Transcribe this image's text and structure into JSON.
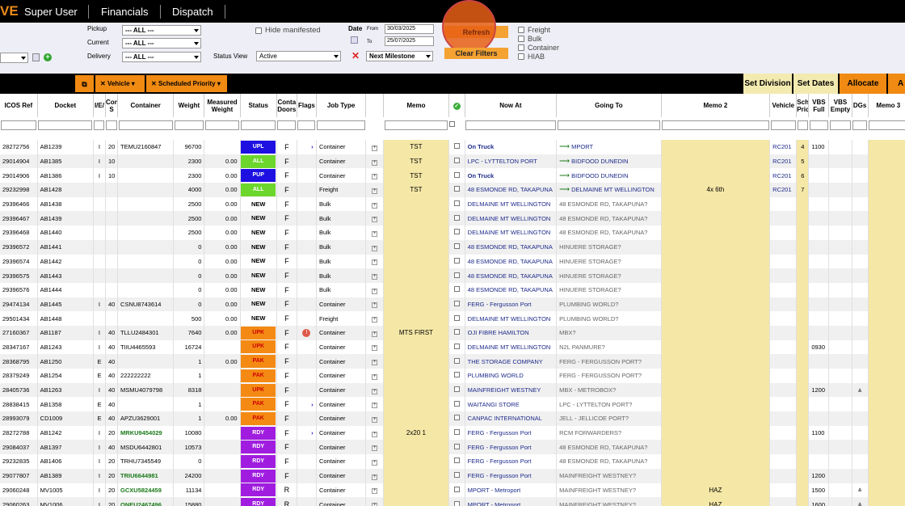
{
  "topbar": {
    "logo": "VE",
    "nav": [
      "Super User",
      "Financials",
      "Dispatch"
    ]
  },
  "filters": {
    "pickup_label": "Pickup",
    "current_label": "Current",
    "delivery_label": "Delivery",
    "pickup_value": "--- ALL ---",
    "current_value": "--- ALL ---",
    "delivery_value": "--- ALL ---",
    "hide_manifested": "Hide manifested",
    "date_label": "Date",
    "from_label": "From",
    "to_label": "To",
    "date_from": "30/03/2025",
    "date_to": "25/07/2025",
    "status_view_label": "Status View",
    "status_view_value": "Active",
    "milestone_value": "Next Milestone",
    "refresh": "Refresh",
    "clear_filters": "Clear Filters",
    "types": [
      "Freight",
      "Bulk",
      "Container",
      "HIAB"
    ]
  },
  "toolbar": {
    "vehicle": "Vehicle",
    "sched": "Scheduled Priority",
    "set_division": "Set Division",
    "set_dates": "Set Dates",
    "allocate": "Allocate",
    "last": "A"
  },
  "columns": [
    "ICOS Ref",
    "Docket",
    "I/E/",
    "Cont. S",
    "Container",
    "Weight",
    "Measured Weight",
    "Status",
    "Conta Doors",
    "Flags",
    "Job Type",
    "",
    "Memo",
    "",
    "Now At",
    "Going To",
    "Memo 2",
    "Vehicle",
    "Sch Pric",
    "VBS Full",
    "VBS Empty",
    "DGs",
    "Memo 3"
  ],
  "rows": [
    {
      "ref": "28272756",
      "docket": "AB1239",
      "ie": "I",
      "size": "20",
      "cont": "TEMU2160847",
      "weight": "96700",
      "mw": "",
      "status": "UPL",
      "doors": "F",
      "flag": "arrow",
      "job": "Container",
      "memo": "TST",
      "now": "On Truck",
      "now_bold": true,
      "going": "MPORT",
      "going_arrow": true,
      "memo2": "",
      "veh": "RC201",
      "sch": "4",
      "vbsf": "1100",
      "vbse": "",
      "dg": false
    },
    {
      "ref": "29014904",
      "docket": "AB1385",
      "ie": "I",
      "size": "10",
      "cont": "",
      "weight": "2300",
      "mw": "0.00",
      "status": "ALL",
      "doors": "F",
      "flag": "",
      "job": "Container",
      "memo": "TST",
      "now": "LPC - LYTTELTON PORT",
      "now_bold": false,
      "going": "BIDFOOD DUNEDIN",
      "going_arrow": true,
      "memo2": "",
      "veh": "RC201",
      "sch": "5",
      "vbsf": "",
      "vbse": "",
      "dg": false
    },
    {
      "ref": "29014906",
      "docket": "AB1386",
      "ie": "I",
      "size": "10",
      "cont": "",
      "weight": "2300",
      "mw": "0.00",
      "status": "PUP",
      "doors": "F",
      "flag": "",
      "job": "Container",
      "memo": "TST",
      "now": "On Truck",
      "now_bold": true,
      "going": "BIDFOOD DUNEDIN",
      "going_arrow": true,
      "memo2": "",
      "veh": "RC201",
      "sch": "6",
      "vbsf": "",
      "vbse": "",
      "dg": false
    },
    {
      "ref": "29232998",
      "docket": "AB1428",
      "ie": "",
      "size": "",
      "cont": "",
      "weight": "4000",
      "mw": "0.00",
      "status": "ALL",
      "doors": "F",
      "flag": "",
      "job": "Freight",
      "memo": "TST",
      "now": "48 ESMONDE RD, TAKAPUNA",
      "now_bold": false,
      "going": "DELMAINE MT WELLINGTON",
      "going_arrow": true,
      "memo2": "4x 6th",
      "veh": "RC201",
      "sch": "7",
      "vbsf": "",
      "vbse": "",
      "dg": false
    },
    {
      "ref": "29396466",
      "docket": "AB1438",
      "ie": "",
      "size": "",
      "cont": "",
      "weight": "2500",
      "mw": "0.00",
      "status": "NEW",
      "doors": "F",
      "flag": "",
      "job": "Bulk",
      "memo": "",
      "now": "DELMAINE MT WELLINGTON",
      "now_bold": false,
      "going": "48 ESMONDE RD, TAKAPUNA?",
      "going_arrow": false,
      "memo2": "",
      "veh": "",
      "sch": "",
      "vbsf": "",
      "vbse": "",
      "dg": false
    },
    {
      "ref": "29396467",
      "docket": "AB1439",
      "ie": "",
      "size": "",
      "cont": "",
      "weight": "2500",
      "mw": "0.00",
      "status": "NEW",
      "doors": "F",
      "flag": "",
      "job": "Bulk",
      "memo": "",
      "now": "DELMAINE MT WELLINGTON",
      "now_bold": false,
      "going": "48 ESMONDE RD, TAKAPUNA?",
      "going_arrow": false,
      "memo2": "",
      "veh": "",
      "sch": "",
      "vbsf": "",
      "vbse": "",
      "dg": false
    },
    {
      "ref": "29396468",
      "docket": "AB1440",
      "ie": "",
      "size": "",
      "cont": "",
      "weight": "2500",
      "mw": "0.00",
      "status": "NEW",
      "doors": "F",
      "flag": "",
      "job": "Bulk",
      "memo": "",
      "now": "DELMAINE MT WELLINGTON",
      "now_bold": false,
      "going": "48 ESMONDE RD, TAKAPUNA?",
      "going_arrow": false,
      "memo2": "",
      "veh": "",
      "sch": "",
      "vbsf": "",
      "vbse": "",
      "dg": false
    },
    {
      "ref": "29396572",
      "docket": "AB1441",
      "ie": "",
      "size": "",
      "cont": "",
      "weight": "0",
      "mw": "0.00",
      "status": "NEW",
      "doors": "F",
      "flag": "",
      "job": "Bulk",
      "memo": "",
      "now": "48 ESMONDE RD, TAKAPUNA",
      "now_bold": false,
      "going": "HINUERE STORAGE?",
      "going_arrow": false,
      "memo2": "",
      "veh": "",
      "sch": "",
      "vbsf": "",
      "vbse": "",
      "dg": false
    },
    {
      "ref": "29396574",
      "docket": "AB1442",
      "ie": "",
      "size": "",
      "cont": "",
      "weight": "0",
      "mw": "0.00",
      "status": "NEW",
      "doors": "F",
      "flag": "",
      "job": "Bulk",
      "memo": "",
      "now": "48 ESMONDE RD, TAKAPUNA",
      "now_bold": false,
      "going": "HINUERE STORAGE?",
      "going_arrow": false,
      "memo2": "",
      "veh": "",
      "sch": "",
      "vbsf": "",
      "vbse": "",
      "dg": false
    },
    {
      "ref": "29396575",
      "docket": "AB1443",
      "ie": "",
      "size": "",
      "cont": "",
      "weight": "0",
      "mw": "0.00",
      "status": "NEW",
      "doors": "F",
      "flag": "",
      "job": "Bulk",
      "memo": "",
      "now": "48 ESMONDE RD, TAKAPUNA",
      "now_bold": false,
      "going": "HINUERE STORAGE?",
      "going_arrow": false,
      "memo2": "",
      "veh": "",
      "sch": "",
      "vbsf": "",
      "vbse": "",
      "dg": false
    },
    {
      "ref": "29396576",
      "docket": "AB1444",
      "ie": "",
      "size": "",
      "cont": "",
      "weight": "0",
      "mw": "0.00",
      "status": "NEW",
      "doors": "F",
      "flag": "",
      "job": "Bulk",
      "memo": "",
      "now": "48 ESMONDE RD, TAKAPUNA",
      "now_bold": false,
      "going": "HINUERE STORAGE?",
      "going_arrow": false,
      "memo2": "",
      "veh": "",
      "sch": "",
      "vbsf": "",
      "vbse": "",
      "dg": false
    },
    {
      "ref": "29474134",
      "docket": "AB1445",
      "ie": "I",
      "size": "40",
      "cont": "CSNU8743614",
      "weight": "0",
      "mw": "0.00",
      "status": "NEW",
      "doors": "F",
      "flag": "",
      "job": "Container",
      "memo": "",
      "now": "FERG - Fergusson Port",
      "now_bold": false,
      "going": "PLUMBING WORLD?",
      "going_arrow": false,
      "memo2": "",
      "veh": "",
      "sch": "",
      "vbsf": "",
      "vbse": "",
      "dg": false
    },
    {
      "ref": "29501434",
      "docket": "AB1448",
      "ie": "",
      "size": "",
      "cont": "",
      "weight": "500",
      "mw": "0.00",
      "status": "NEW",
      "doors": "F",
      "flag": "",
      "job": "Freight",
      "memo": "",
      "now": "DELMAINE MT WELLINGTON",
      "now_bold": false,
      "going": "PLUMBING WORLD?",
      "going_arrow": false,
      "memo2": "",
      "veh": "",
      "sch": "",
      "vbsf": "",
      "vbse": "",
      "dg": false
    },
    {
      "ref": "27160367",
      "docket": "AB1187",
      "ie": "I",
      "size": "40",
      "cont": "TLLU2484301",
      "weight": "7640",
      "mw": "0.00",
      "status": "UPK",
      "doors": "F",
      "flag": "alert",
      "job": "Container",
      "memo": "MTS FIRST",
      "now": "OJI FIBRE HAMILTON",
      "now_bold": false,
      "going": "MBX?",
      "going_arrow": false,
      "memo2": "",
      "veh": "",
      "sch": "",
      "vbsf": "",
      "vbse": "",
      "dg": false
    },
    {
      "ref": "28347167",
      "docket": "AB1243",
      "ie": "I",
      "size": "40",
      "cont": "TIIU4465593",
      "weight": "16724",
      "mw": "",
      "status": "UPK",
      "doors": "F",
      "flag": "",
      "job": "Container",
      "memo": "",
      "now": "DELMAINE MT WELLINGTON",
      "now_bold": false,
      "going": "N2L PANMURE?",
      "going_arrow": false,
      "memo2": "",
      "veh": "",
      "sch": "",
      "vbsf": "0930",
      "vbse": "",
      "dg": false
    },
    {
      "ref": "28368795",
      "docket": "AB1250",
      "ie": "E",
      "size": "40",
      "cont": "",
      "weight": "1",
      "mw": "0.00",
      "status": "PAK",
      "doors": "F",
      "flag": "",
      "job": "Container",
      "memo": "",
      "now": "THE STORAGE COMPANY",
      "now_bold": false,
      "going": "FERG - FERGUSSON PORT?",
      "going_arrow": false,
      "memo2": "",
      "veh": "",
      "sch": "",
      "vbsf": "",
      "vbse": "",
      "dg": false
    },
    {
      "ref": "28379249",
      "docket": "AB1254",
      "ie": "E",
      "size": "40",
      "cont": "222222222",
      "weight": "1",
      "mw": "",
      "status": "PAK",
      "doors": "F",
      "flag": "",
      "job": "Container",
      "memo": "",
      "now": "PLUMBING WORLD",
      "now_bold": false,
      "going": "FERG - FERGUSSON PORT?",
      "going_arrow": false,
      "memo2": "",
      "veh": "",
      "sch": "",
      "vbsf": "",
      "vbse": "",
      "dg": false
    },
    {
      "ref": "28405736",
      "docket": "AB1263",
      "ie": "I",
      "size": "40",
      "cont": "MSMU4079798",
      "weight": "8318",
      "mw": "",
      "status": "UPK",
      "doors": "F",
      "flag": "",
      "job": "Container",
      "memo": "",
      "now": "MAINFREIGHT WESTNEY",
      "now_bold": false,
      "going": "MBX - METROBOX?",
      "going_arrow": false,
      "memo2": "",
      "veh": "",
      "sch": "",
      "vbsf": "1200",
      "vbse": "",
      "dg": true
    },
    {
      "ref": "28838415",
      "docket": "AB1358",
      "ie": "E",
      "size": "40",
      "cont": "",
      "weight": "1",
      "mw": "",
      "status": "PAK",
      "doors": "F",
      "flag": "arrow",
      "job": "Container",
      "memo": "",
      "now": "WAITANGI STORE",
      "now_bold": false,
      "going": "LPC - LYTTELTON PORT?",
      "going_arrow": false,
      "memo2": "",
      "veh": "",
      "sch": "",
      "vbsf": "",
      "vbse": "",
      "dg": false
    },
    {
      "ref": "28993079",
      "docket": "CD1009",
      "ie": "E",
      "size": "40",
      "cont": "APZU3629001",
      "weight": "1",
      "mw": "0.00",
      "status": "PAK",
      "doors": "F",
      "flag": "",
      "job": "Container",
      "memo": "",
      "now": "CANPAC INTERNATIONAL",
      "now_bold": false,
      "going": "JELL - JELLICOE PORT?",
      "going_arrow": false,
      "memo2": "",
      "veh": "",
      "sch": "",
      "vbsf": "",
      "vbse": "",
      "dg": false
    },
    {
      "ref": "28272788",
      "docket": "AB1242",
      "ie": "I",
      "size": "20",
      "cont": "MRKU9454029",
      "cont_green": true,
      "weight": "10080",
      "mw": "",
      "status": "RDY",
      "doors": "F",
      "flag": "arrow",
      "job": "Container",
      "memo": "2x20 1",
      "now": "FERG - Fergusson Port",
      "now_bold": false,
      "going": "RCM FORWARDERS?",
      "going_arrow": false,
      "memo2": "",
      "veh": "",
      "sch": "",
      "vbsf": "1100",
      "vbse": "",
      "dg": false
    },
    {
      "ref": "29084037",
      "docket": "AB1397",
      "ie": "I",
      "size": "40",
      "cont": "MSDU6442801",
      "weight": "10573",
      "mw": "",
      "status": "RDY",
      "doors": "F",
      "flag": "",
      "job": "Container",
      "memo": "",
      "now": "FERG - Fergusson Port",
      "now_bold": false,
      "going": "48 ESMONDE RD, TAKAPUNA?",
      "going_arrow": false,
      "memo2": "",
      "veh": "",
      "sch": "",
      "vbsf": "",
      "vbse": "",
      "dg": false
    },
    {
      "ref": "29232835",
      "docket": "AB1406",
      "ie": "I",
      "size": "20",
      "cont": "TRHU7345549",
      "weight": "0",
      "mw": "",
      "status": "RDY",
      "doors": "F",
      "flag": "",
      "job": "Container",
      "memo": "",
      "now": "FERG - Fergusson Port",
      "now_bold": false,
      "going": "48 ESMONDE RD, TAKAPUNA?",
      "going_arrow": false,
      "memo2": "",
      "veh": "",
      "sch": "",
      "vbsf": "",
      "vbse": "",
      "dg": false
    },
    {
      "ref": "29077807",
      "docket": "AB1389",
      "ie": "I",
      "size": "20",
      "cont": "TRIU6644981",
      "cont_green": true,
      "weight": "24200",
      "mw": "",
      "status": "RDY",
      "doors": "F",
      "flag": "",
      "job": "Container",
      "memo": "",
      "now": "FERG - Fergusson Port",
      "now_bold": false,
      "going": "MAINFREIGHT WESTNEY?",
      "going_arrow": false,
      "memo2": "",
      "veh": "",
      "sch": "",
      "vbsf": "1200",
      "vbse": "",
      "dg": false
    },
    {
      "ref": "29060248",
      "docket": "MV1005",
      "ie": "I",
      "size": "20",
      "cont": "GCXU5824459",
      "cont_green": true,
      "weight": "11134",
      "mw": "",
      "status": "RDY",
      "doors": "R",
      "flag": "",
      "job": "Container",
      "memo": "",
      "now": "MPORT - Metroport",
      "now_bold": false,
      "going": "MAINFREIGHT WESTNEY?",
      "going_arrow": false,
      "memo2": "HAZ",
      "veh": "",
      "sch": "",
      "vbsf": "1500",
      "vbse": "",
      "dg": true
    },
    {
      "ref": "29060263",
      "docket": "MV1006",
      "ie": "I",
      "size": "20",
      "cont": "ONEU2467496",
      "cont_green": true,
      "weight": "15880",
      "mw": "",
      "status": "RDY",
      "doors": "R",
      "flag": "",
      "job": "Container",
      "memo": "",
      "now": "MPORT - Metroport",
      "now_bold": false,
      "going": "MAINFREIGHT WESTNEY?",
      "going_arrow": false,
      "memo2": "HAZ",
      "veh": "",
      "sch": "",
      "vbsf": "1600",
      "vbse": "",
      "dg": true
    }
  ]
}
